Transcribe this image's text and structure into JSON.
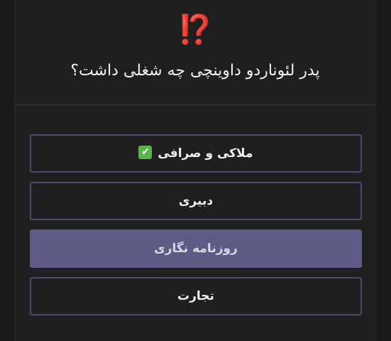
{
  "header": {
    "emoji": "⁉️",
    "question": "پدر لئوناردو داوینچی چه شغلی داشت؟"
  },
  "options": [
    {
      "label": "ملاکی و صرافی",
      "has_check": true,
      "check_icon": "✔"
    },
    {
      "label": "دبیری",
      "has_check": false
    },
    {
      "label": "روزنامه نگاری",
      "has_check": false,
      "selected": true
    },
    {
      "label": "تجارت",
      "has_check": false
    }
  ],
  "colors": {
    "background": "#1f1f1f",
    "option_border": "#4d4b6a",
    "selected_fill": "#5e5c86",
    "check_green": "#57b64a",
    "emoji_red": "#e53935"
  }
}
